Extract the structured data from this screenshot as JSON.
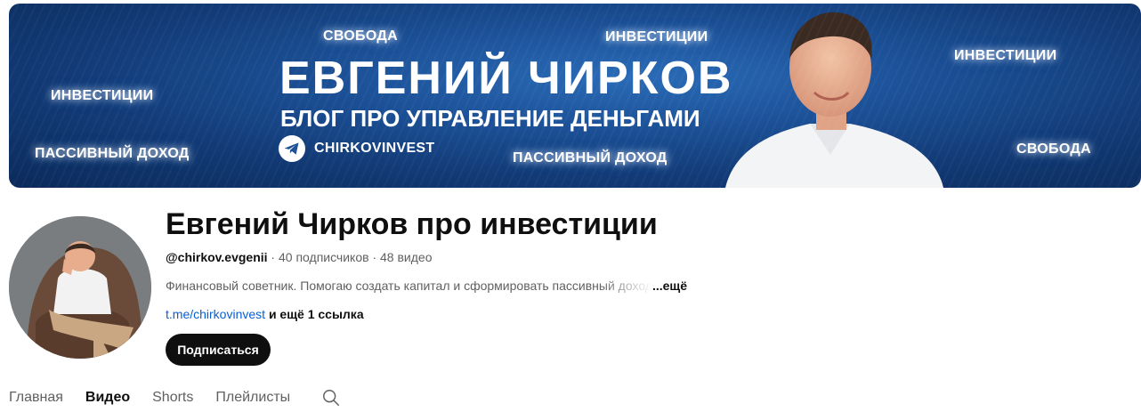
{
  "banner": {
    "name": "ЕВГЕНИЙ ЧИРКОВ",
    "subtitle": "БЛОГ ПРО УПРАВЛЕНИЕ ДЕНЬГАМИ",
    "telegram": "CHIRKOVINVEST",
    "keywords": [
      "СВОБОДА",
      "ИНВЕСТИЦИИ",
      "ИНВЕСТИЦИИ",
      "ИНВЕСТИЦИИ",
      "ПАССИВНЫЙ ДОХОД",
      "ПАССИВНЫЙ ДОХОД",
      "СВОБОДА"
    ]
  },
  "channel": {
    "title": "Евгений Чирков про инвестиции",
    "handle": "@chirkov.evgenii",
    "subscribers": "40 подписчиков",
    "videos": "48 видео",
    "separator": " · ",
    "description": "Финансовый советник. Помогаю создать капитал и сформировать пассивный доход",
    "more": "...ещё",
    "link": "t.me/chirkovinvest",
    "more_links": "и ещё 1 ссылка",
    "subscribe_label": "Подписаться"
  },
  "tabs": [
    {
      "label": "Главная",
      "active": false
    },
    {
      "label": "Видео",
      "active": true
    },
    {
      "label": "Shorts",
      "active": false
    },
    {
      "label": "Плейлисты",
      "active": false
    }
  ],
  "colors": {
    "accent": "#0f0f0f",
    "link": "#065fd4",
    "muted": "#606060",
    "banner": "#1b4f95"
  }
}
